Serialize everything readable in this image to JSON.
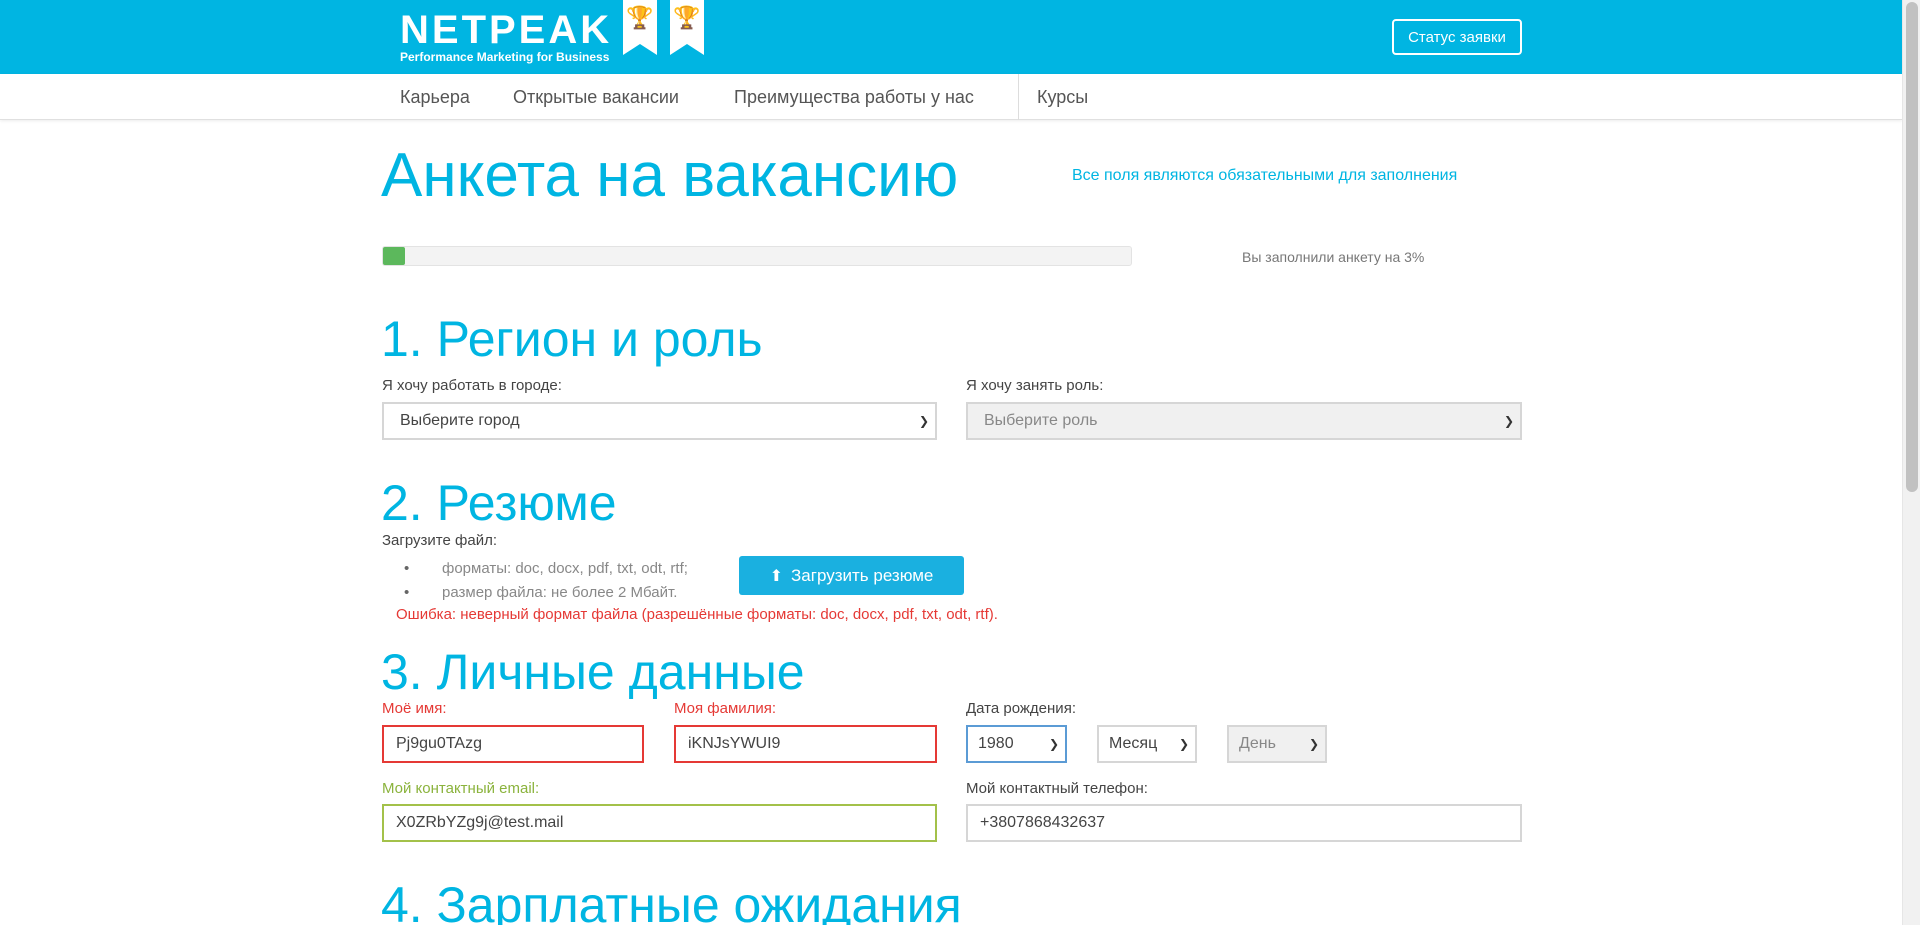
{
  "header": {
    "logo_text": "NETPEAK",
    "logo_tagline": "Performance Marketing for Business",
    "status_button": "Статус заявки",
    "brand_color": "#00b5e2"
  },
  "nav": {
    "items": [
      "Карьера",
      "Открытые вакансии",
      "Преимущества работы у нас",
      "Курсы"
    ]
  },
  "page": {
    "title": "Анкета на вакансию",
    "required_note": "Все поля являются обязательными для заполнения",
    "progress_percent": 3,
    "progress_text": "Вы заполнили анкету на 3%"
  },
  "section1": {
    "title": "1. Регион и роль",
    "city_label": "Я хочу работать в городе:",
    "city_value": "Выберите город",
    "role_label": "Я хочу занять роль:",
    "role_value": "Выберите роль"
  },
  "section2": {
    "title": "2. Резюме",
    "upload_label": "Загрузите файл:",
    "formats": "форматы: doc, docx, pdf, txt, odt, rtf;",
    "size": "размер файла: не более 2 Мбайт.",
    "upload_button": "Загрузить резюме",
    "error": "Ошибка: неверный формат файла (разрешённые форматы: doc, docx, pdf, txt, odt, rtf)."
  },
  "section3": {
    "title": "3. Личные данные",
    "first_name_label": "Моё имя:",
    "first_name_value": "Pj9gu0TAzg",
    "last_name_label": "Моя фамилия:",
    "last_name_value": "iKNJsYWUI9",
    "birth_label": "Дата рождения:",
    "birth_year": "1980",
    "birth_month": "Месяц",
    "birth_day": "День",
    "email_label": "Мой контактный email:",
    "email_value": "X0ZRbYZg9j@test.mail",
    "phone_label": "Мой контактный телефон:",
    "phone_value": "+3807868432637"
  },
  "section4": {
    "title": "4. Зарплатные ожидания"
  }
}
